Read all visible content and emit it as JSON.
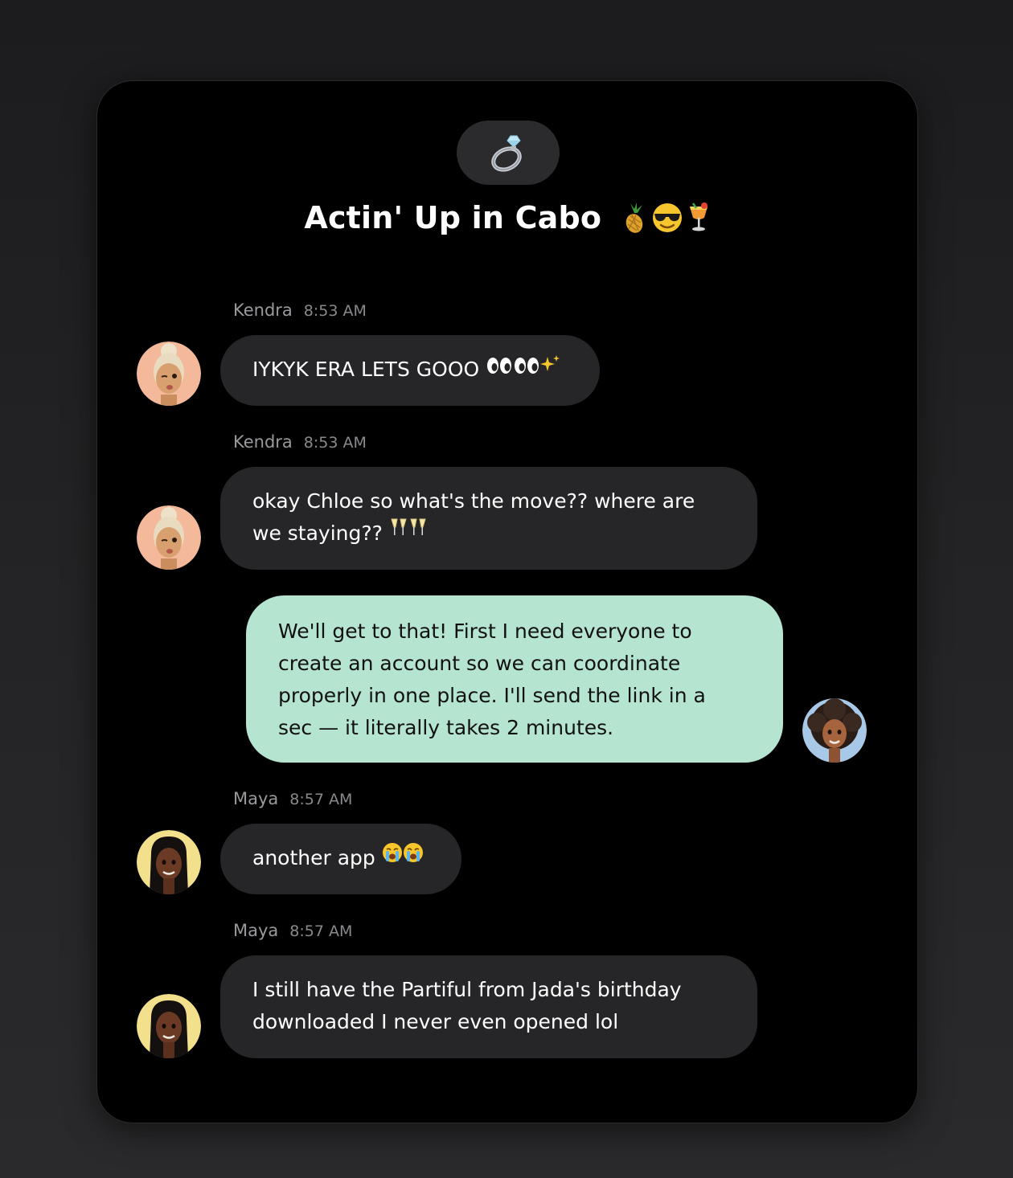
{
  "group": {
    "icon": "ring-icon",
    "title": "Actin' Up in Cabo",
    "title_emojis": [
      "pineapple-emoji",
      "sunglasses-face-emoji",
      "tropical-drink-emoji"
    ]
  },
  "messages": [
    {
      "sender": "Kendra",
      "time": "8:53 AM",
      "text": "IYKYK ERA LETS GOOO",
      "emojis": [
        "eyes-emoji",
        "eyes-emoji",
        "sparkles-emoji"
      ]
    },
    {
      "sender": "Kendra",
      "time": "8:53 AM",
      "text_line1": "okay Chloe so what's the move?? where are",
      "text_line2": "we staying??",
      "emojis": [
        "champagne-glasses-emoji",
        "champagne-glasses-emoji"
      ]
    },
    {
      "sender": "",
      "time": "",
      "outgoing": true,
      "text_lines": [
        "We'll get to that! First I need everyone to",
        "create an account so we can coordinate",
        "properly in one place. I'll send the link in a",
        "sec — it literally takes 2 minutes."
      ]
    },
    {
      "sender": "Maya",
      "time": "8:57 AM",
      "text": "another app",
      "emojis": [
        "loudly-crying-face-emoji",
        "loudly-crying-face-emoji"
      ]
    },
    {
      "sender": "Maya",
      "time": "8:57 AM",
      "text_lines": [
        "I still have the Partiful from Jada's birthday",
        "downloaded I never even opened lol"
      ]
    }
  ],
  "colors": {
    "page_background": "#1c1c1e",
    "card_background": "#000000",
    "incoming_bubble": "#262628",
    "outgoing_bubble": "#b5e4d1",
    "meta_text": "#9a9a9e"
  }
}
